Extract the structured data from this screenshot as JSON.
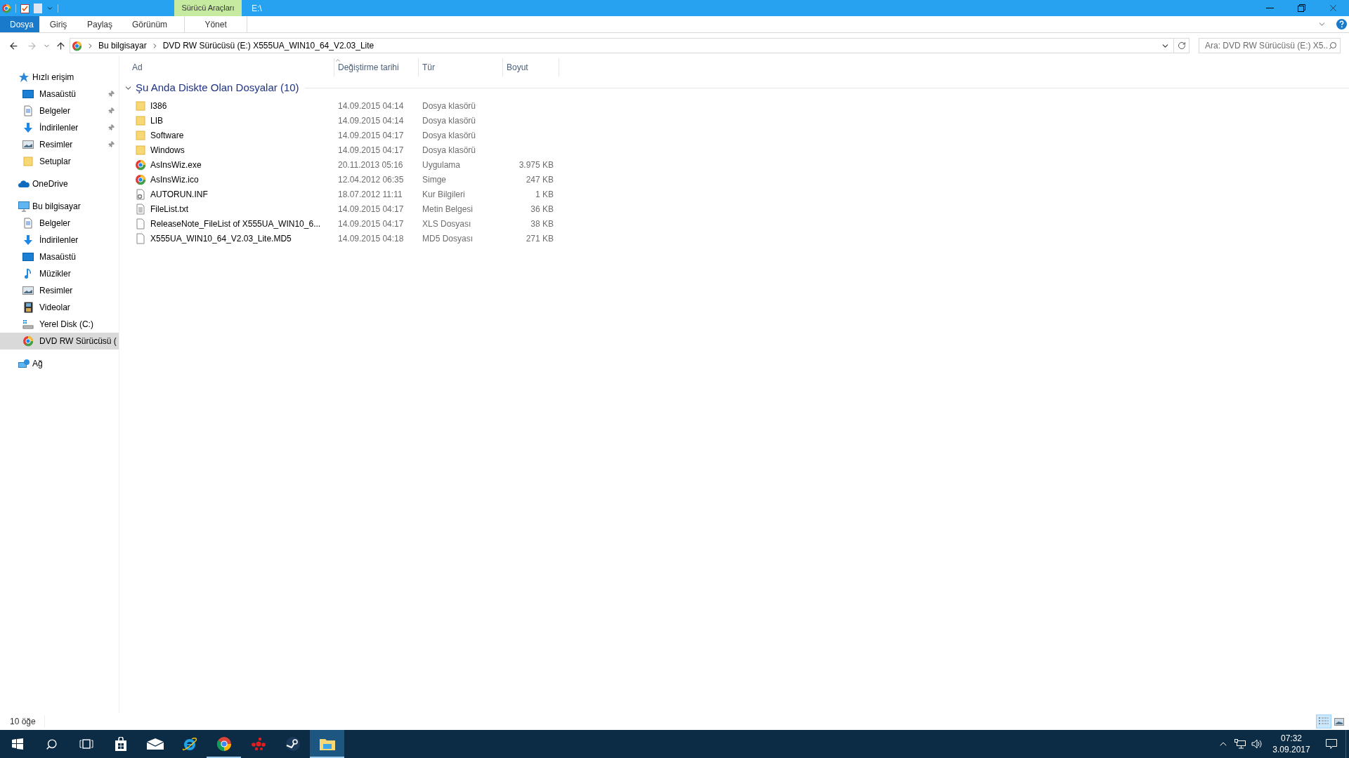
{
  "title_bar": {
    "context_tab": "Sürücü Araçları",
    "path": "E:\\"
  },
  "ribbon_tabs": [
    {
      "label": "Dosya",
      "selected": true
    },
    {
      "label": "Giriş",
      "selected": false
    },
    {
      "label": "Paylaş",
      "selected": false
    },
    {
      "label": "Görünüm",
      "selected": false
    }
  ],
  "context_ribbon_tab": {
    "label": "Yönet",
    "selected": false
  },
  "address_bar": {
    "breadcrumbs": [
      "Bu bilgisayar",
      "DVD RW Sürücüsü (E:) X555UA_WIN10_64_V2.03_Lite"
    ]
  },
  "search": {
    "placeholder": "Ara: DVD RW Sürücüsü (E:) X5..."
  },
  "sidebar": {
    "items": [
      {
        "label": "Hızlı erişim",
        "kind": "star",
        "selected": false,
        "children": [
          {
            "label": "Masaüstü",
            "kind": "desktop",
            "pinned": true,
            "selected": false
          },
          {
            "label": "Belgeler",
            "kind": "document",
            "pinned": true,
            "selected": false
          },
          {
            "label": "İndirilenler",
            "kind": "download",
            "pinned": true,
            "selected": false
          },
          {
            "label": "Resimler",
            "kind": "pictures",
            "pinned": true,
            "selected": false
          },
          {
            "label": "Setuplar",
            "kind": "folder",
            "pinned": false,
            "selected": false
          }
        ]
      },
      {
        "label": "OneDrive",
        "kind": "cloud",
        "selected": false
      },
      {
        "label": "Bu bilgisayar",
        "kind": "computer",
        "selected": false,
        "children": [
          {
            "label": "Belgeler",
            "kind": "document",
            "selected": false
          },
          {
            "label": "İndirilenler",
            "kind": "download",
            "selected": false
          },
          {
            "label": "Masaüstü",
            "kind": "desktop",
            "selected": false
          },
          {
            "label": "Müzikler",
            "kind": "music",
            "selected": false
          },
          {
            "label": "Resimler",
            "kind": "pictures",
            "selected": false
          },
          {
            "label": "Videolar",
            "kind": "video",
            "selected": false
          },
          {
            "label": "Yerel Disk (C:)",
            "kind": "disk",
            "selected": false
          },
          {
            "label": "DVD RW Sürücüsü (",
            "kind": "disc",
            "selected": true
          }
        ]
      },
      {
        "label": "Ağ",
        "kind": "network",
        "selected": false
      }
    ]
  },
  "table": {
    "columns": [
      "Ad",
      "Değiştirme tarihi",
      "Tür",
      "Boyut"
    ],
    "group": {
      "label": "Şu Anda Diskte Olan Dosyalar (10)",
      "expanded": true
    },
    "rows": [
      {
        "kind": "folder",
        "name": "I386",
        "date": "14.09.2015 04:14",
        "type": "Dosya klasörü"
      },
      {
        "kind": "folder",
        "name": "LIB",
        "date": "14.09.2015 04:14",
        "type": "Dosya klasörü"
      },
      {
        "kind": "folder",
        "name": "Software",
        "date": "14.09.2015 04:17",
        "type": "Dosya klasörü"
      },
      {
        "kind": "folder",
        "name": "Windows",
        "date": "14.09.2015 04:17",
        "type": "Dosya klasörü"
      },
      {
        "kind": "disc",
        "name": "AsInsWiz.exe",
        "date": "20.11.2013 05:16",
        "type": "Uygulama",
        "size": "3.975 KB"
      },
      {
        "kind": "disc",
        "name": "AsInsWiz.ico",
        "date": "12.04.2012 06:35",
        "type": "Simge",
        "size": "247 KB"
      },
      {
        "kind": "settings",
        "name": "AUTORUN.INF",
        "date": "18.07.2012 11:11",
        "type": "Kur Bilgileri",
        "size": "1 KB"
      },
      {
        "kind": "text",
        "name": "FileList.txt",
        "date": "14.09.2015 04:17",
        "type": "Metin Belgesi",
        "size": "36 KB"
      },
      {
        "kind": "blank",
        "name": "ReleaseNote_FileList of X555UA_WIN10_6...",
        "date": "14.09.2015 04:17",
        "type": "XLS Dosyası",
        "size": "38 KB"
      },
      {
        "kind": "blank",
        "name": "X555UA_WIN10_64_V2.03_Lite.MD5",
        "date": "14.09.2015 04:18",
        "type": "MD5 Dosyası",
        "size": "271 KB"
      }
    ]
  },
  "status_bar": {
    "count": "10 öğe",
    "views": [
      {
        "kind": "details",
        "selected": true
      },
      {
        "kind": "thumbnails",
        "selected": false
      }
    ]
  },
  "taskbar": {
    "items": [
      {
        "kind": "start",
        "running": false,
        "active": false
      },
      {
        "kind": "search",
        "running": false,
        "active": false
      },
      {
        "kind": "taskview",
        "running": false,
        "active": false
      },
      {
        "kind": "store",
        "running": false,
        "active": false
      },
      {
        "kind": "mail",
        "running": false,
        "active": false
      },
      {
        "kind": "ie",
        "running": false,
        "active": false
      },
      {
        "kind": "chrome",
        "running": true,
        "active": false
      },
      {
        "kind": "cluster",
        "running": false,
        "active": false
      },
      {
        "kind": "steam",
        "running": false,
        "active": false
      },
      {
        "kind": "explorer",
        "running": true,
        "active": true
      }
    ],
    "time": "07:32",
    "date": "3.09.2017"
  }
}
